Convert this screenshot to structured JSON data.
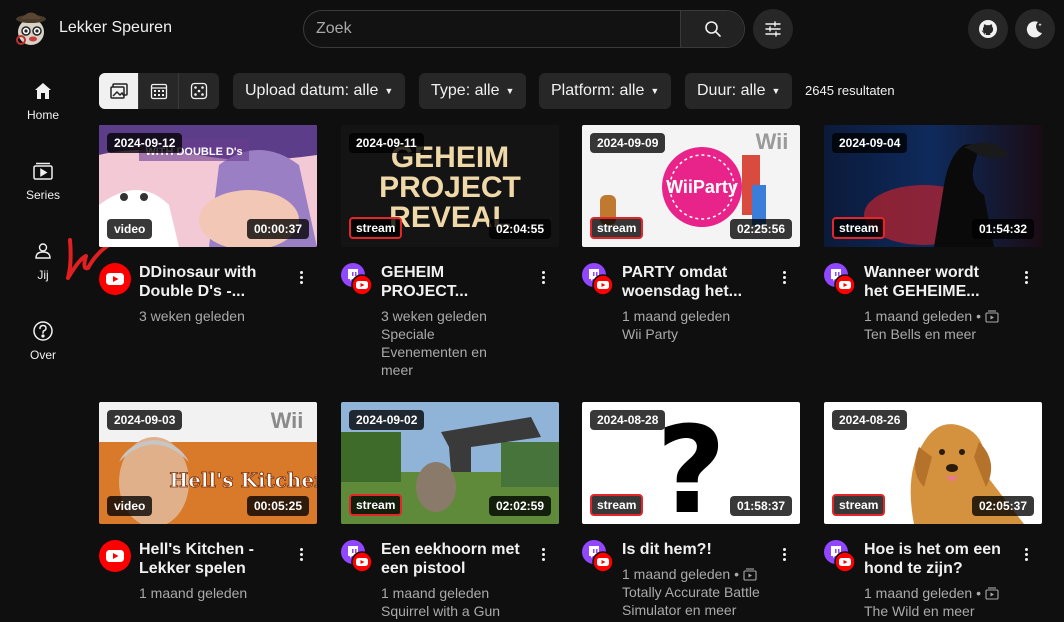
{
  "app": {
    "title": "Lekker Speuren"
  },
  "search": {
    "placeholder": "Zoek"
  },
  "icons": {
    "logo": "detective-mascot-logo",
    "search": "search-icon",
    "filters": "sliders-icon",
    "github": "github-icon",
    "theme": "moon-icon"
  },
  "sidebar": {
    "items": [
      {
        "label": "Home",
        "icon": "home-icon"
      },
      {
        "label": "Series",
        "icon": "series-icon"
      },
      {
        "label": "Jij",
        "icon": "user-icon"
      },
      {
        "label": "Over",
        "icon": "help-icon"
      }
    ]
  },
  "filters": {
    "view_modes": [
      "thumbnail-grid",
      "calendar",
      "random"
    ],
    "upload": "Upload datum: alle",
    "type": "Type: alle",
    "platform": "Platform: alle",
    "duration": "Duur: alle",
    "results": "2645 resultaten"
  },
  "colors": {
    "background": "#0f0f0f",
    "chip": "#272727",
    "youtube": "#ff0000",
    "twitch": "#9146ff",
    "stream_border": "#e4262b"
  },
  "videos": [
    {
      "date": "2024-09-12",
      "kind": "video",
      "duration": "00:00:37",
      "title_1": "DDinosaur with",
      "title_2": "Double D's -...",
      "age": "3 weken geleden",
      "series_1": "",
      "series_2": "",
      "platform": "youtube",
      "thumb_text": "WITH DOUBLE D's"
    },
    {
      "date": "2024-09-11",
      "kind": "stream",
      "duration": "02:04:55",
      "title_1": "GEHEIM",
      "title_2": "PROJECT...",
      "age": "3 weken geleden",
      "series_1": "Speciale",
      "series_2": "Evenementen en",
      "series_3": "meer",
      "platform": "twitch",
      "thumb_text_1": "GEHEIM",
      "thumb_text_2": "PROJECT",
      "thumb_text_3": "REVEAL"
    },
    {
      "date": "2024-09-09",
      "kind": "stream",
      "duration": "02:25:56",
      "title_1": "PARTY omdat",
      "title_2": "woensdag het...",
      "age": "1 maand geleden",
      "series_1": "Wii Party",
      "series_2": "",
      "platform": "twitch",
      "thumb_text": "Wii",
      "thumb_text_2": "WiiParty"
    },
    {
      "date": "2024-09-04",
      "kind": "stream",
      "duration": "01:54:32",
      "title_1": "Wanneer wordt",
      "title_2": "het GEHEIME...",
      "age": "1 maand geleden",
      "series_1": "Ten Bells en meer",
      "series_2": "",
      "platform": "twitch",
      "series_icon": true
    },
    {
      "date": "2024-09-03",
      "kind": "video",
      "duration": "00:05:25",
      "title_1": "Hell's Kitchen -",
      "title_2": "Lekker spelen",
      "age": "1 maand geleden",
      "series_1": "",
      "series_2": "",
      "platform": "youtube",
      "thumb_text": "Wii",
      "thumb_text_2": "Hell's Kitchen"
    },
    {
      "date": "2024-09-02",
      "kind": "stream",
      "duration": "02:02:59",
      "title_1": "Een eekhoorn met",
      "title_2": "een pistool",
      "age": "1 maand geleden",
      "series_1": "Squirrel with a Gun",
      "series_2": "",
      "platform": "twitch"
    },
    {
      "date": "2024-08-28",
      "kind": "stream",
      "duration": "01:58:37",
      "title_1": "Is dit hem?!",
      "title_2": "",
      "age": "1 maand geleden",
      "series_1": "Totally Accurate Battle",
      "series_2": "Simulator en meer",
      "platform": "twitch",
      "series_icon": true,
      "thumb_text": "?"
    },
    {
      "date": "2024-08-26",
      "kind": "stream",
      "duration": "02:05:37",
      "title_1": "Hoe is het om een",
      "title_2": "hond te zijn?",
      "age": "1 maand geleden",
      "series_1": "The Wild en meer",
      "series_2": "",
      "platform": "twitch",
      "series_icon": true
    }
  ]
}
